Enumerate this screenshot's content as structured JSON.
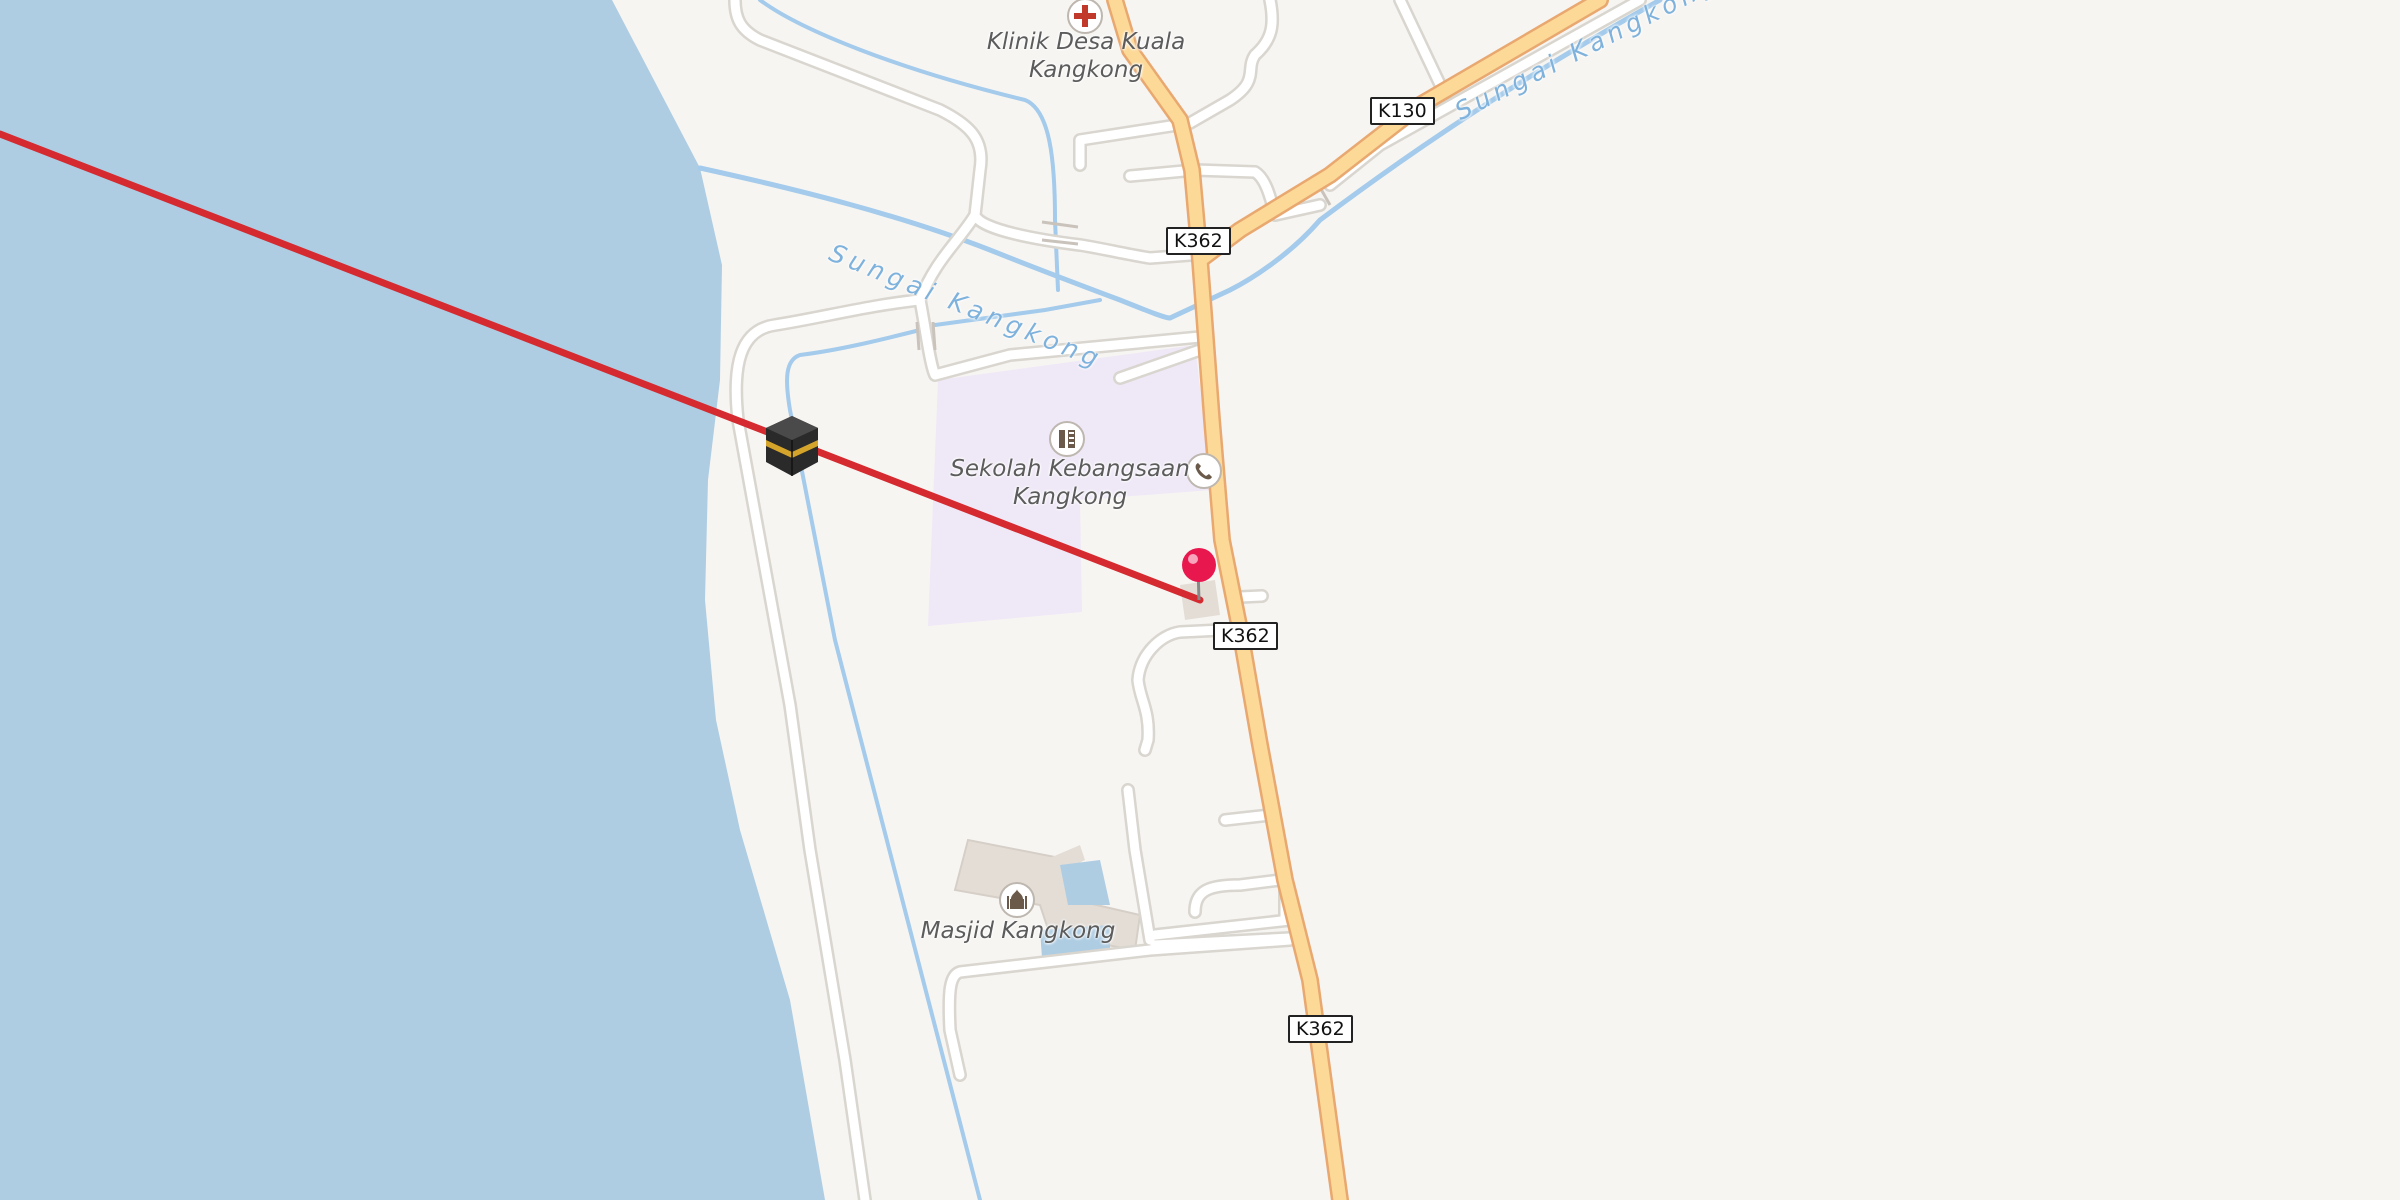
{
  "map": {
    "labels": {
      "clinic": [
        "Klinik Desa Kuala",
        "Kangkong"
      ],
      "school": [
        "Sekolah Kebangsaan",
        "Kangkong"
      ],
      "mosque": "Masjid Kangkong"
    },
    "rivers": {
      "river_1": "Sungai Kangkong",
      "river_2": "Sungai Kangkong"
    },
    "road_shields": {
      "k130": "K130",
      "k362_a": "K362",
      "k362_b": "K362",
      "k362_c": "K362"
    },
    "icons": {
      "clinic": "hospital-cross-icon",
      "school": "school-icon",
      "phone": "telephone-icon",
      "mosque": "mosque-icon",
      "kaaba": "kaaba-icon",
      "pin": "location-pin-icon"
    },
    "colors": {
      "sea": "#aecde3",
      "land": "#f7f5f2",
      "qibla_line": "#d42a30",
      "main_road": "#fcd996",
      "main_road_casing": "#e8a870",
      "minor_road": "#ffffff",
      "minor_road_casing": "#d9d5cf",
      "river": "#a4cbeb",
      "school_area": "#efe8f7",
      "pin": "#e8174e"
    }
  }
}
